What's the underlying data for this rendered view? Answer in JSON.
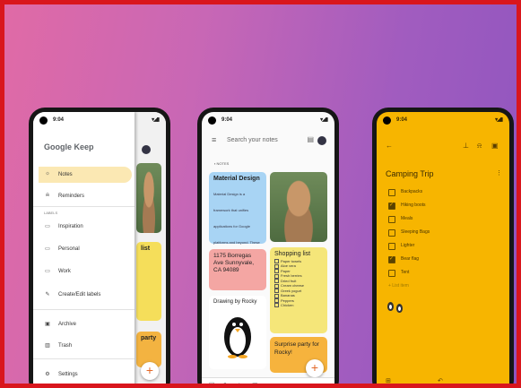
{
  "colors": {
    "frame_border": "#d9161d",
    "keep_yellow": "#f7b500",
    "selected_nav": "#fbe8b3"
  },
  "phone1": {
    "time": "9:04",
    "signal": "▾◢▮",
    "logo_google": "Google",
    "logo_keep": "Keep",
    "nav": {
      "notes": "Notes",
      "reminders": "Reminders",
      "labels_header": "LABELS",
      "inspiration": "Inspiration",
      "personal": "Personal",
      "work": "Work",
      "create_labels": "Create/Edit labels",
      "archive": "Archive",
      "trash": "Trash",
      "settings": "Settings"
    },
    "behind": {
      "list_label": "list",
      "party_label": "party"
    }
  },
  "phone2": {
    "time": "9:04",
    "signal": "▾◢▮",
    "search_placeholder": "Search your notes",
    "notes_label": "NOTES",
    "card_material": {
      "title": "Material Design",
      "body": "Material Design is a framework that unifies applications for Google platforms and beyond. These principles are beneficial to a wide audience."
    },
    "card_address": {
      "text": "1175 Borregas Ave Sunnyvale, CA 94089"
    },
    "card_shopping": {
      "title": "Shopping list",
      "items": [
        "Paper towels",
        "Aloe vera",
        "Paper",
        "Fresh berries",
        "Dried fruit",
        "Cream cheese",
        "Greek yogurt",
        "Bananas",
        "Peppers",
        "Chicken"
      ]
    },
    "card_drawing": {
      "title": "Drawing by Rocky"
    },
    "card_party": {
      "text": "Surprise party for Rocky!"
    }
  },
  "phone3": {
    "time": "9:04",
    "signal": "▾◢▮",
    "title": "Camping Trip",
    "items": [
      {
        "label": "Backpacks",
        "checked": false
      },
      {
        "label": "Hiking boots",
        "checked": true
      },
      {
        "label": "Meals",
        "checked": false
      },
      {
        "label": "Sleeping Bags",
        "checked": false
      },
      {
        "label": "Lighter",
        "checked": false
      },
      {
        "label": "Bear flag",
        "checked": true
      },
      {
        "label": "Tent",
        "checked": false
      }
    ],
    "add_item": "+ List item"
  }
}
